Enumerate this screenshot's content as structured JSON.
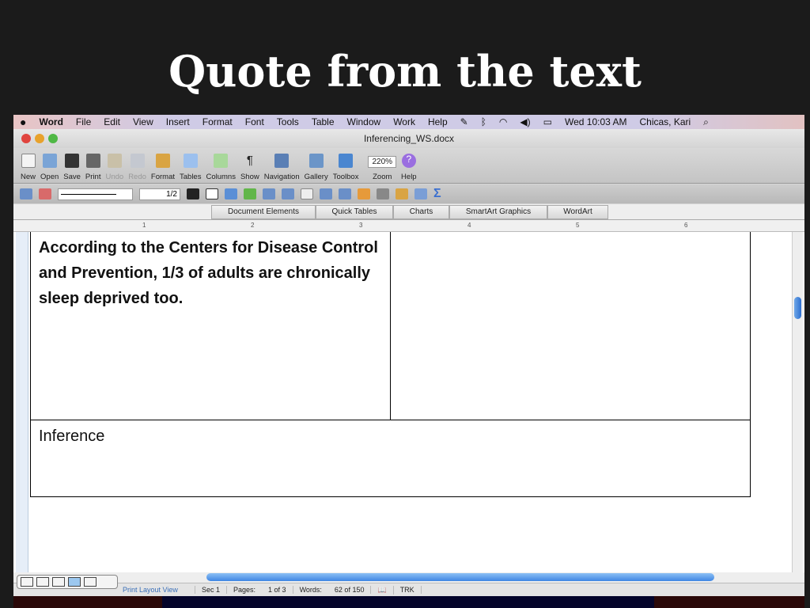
{
  "slide_title": "Quote from the text",
  "menubar": {
    "app": "Word",
    "items": [
      "File",
      "Edit",
      "View",
      "Insert",
      "Format",
      "Font",
      "Tools",
      "Table",
      "Window",
      "Work",
      "Help"
    ],
    "clock": "Wed 10:03 AM",
    "user": "Chicas, Kari"
  },
  "window": {
    "title": "Inferencing_WS.docx"
  },
  "toolbar": {
    "buttons": [
      "New",
      "Open",
      "Save",
      "Print",
      "Undo",
      "Redo",
      "Format",
      "Tables",
      "Columns",
      "Show",
      "Navigation",
      "Gallery",
      "Toolbox"
    ],
    "zoom_value": "220%",
    "zoom_label": "Zoom",
    "help": "Help"
  },
  "format_bar": {
    "line_weight": "1/2"
  },
  "ribbon": {
    "tabs": [
      "Document Elements",
      "Quick Tables",
      "Charts",
      "SmartArt Graphics",
      "WordArt"
    ]
  },
  "ruler": {
    "marks": [
      "1",
      "2",
      "3",
      "4",
      "5",
      "6"
    ]
  },
  "document": {
    "quote": "According to the Centers for Disease Control and Prevention, 1/3 of adults are chronically sleep deprived too.",
    "inference_label": "Inference"
  },
  "status": {
    "view": "Print Layout View",
    "sec": "Sec    1",
    "pages_label": "Pages:",
    "pages": "1 of 3",
    "words_label": "Words:",
    "words": "62 of 150",
    "trk": "TRK"
  }
}
